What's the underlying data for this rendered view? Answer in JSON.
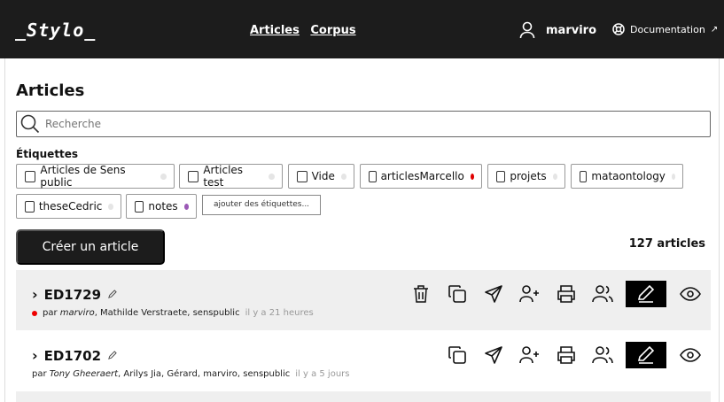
{
  "header": {
    "logo": "_Stylo_",
    "nav": [
      "Articles",
      "Corpus"
    ],
    "username": "marviro",
    "docs": "Documentation"
  },
  "page": {
    "title": "Articles",
    "search_placeholder": "Recherche",
    "tags_label": "Étiquettes",
    "tags": [
      {
        "label": "Articles de Sens public",
        "dot": "#e5e5e5"
      },
      {
        "label": "Articles test",
        "dot": "#e5e5e5"
      },
      {
        "label": "Vide",
        "dot": "#e5e5e5"
      },
      {
        "label": "articlesMarcello",
        "dot": "#e00000"
      },
      {
        "label": "projets",
        "dot": "#e5e5e5"
      },
      {
        "label": "mataontology",
        "dot": "#e5e5e5"
      },
      {
        "label": "theseCedric",
        "dot": "#e5e5e5"
      },
      {
        "label": "notes",
        "dot": "#9b59b6"
      }
    ],
    "add_tags": "ajouter des étiquettes...",
    "create_button": "Créer un article",
    "count": "127 articles"
  },
  "articles": [
    {
      "title": "ED1729",
      "by": "par ",
      "owner": "marviro",
      "others": ", Mathilde Verstraete, senspublic",
      "ago": "il y a 21 heures",
      "tag_dot": "#e00000"
    },
    {
      "title": "ED1702",
      "by": "par ",
      "owner": "Tony Gheeraert",
      "others": ", Arilys Jia, Gérard, marviro, senspublic",
      "ago": "il y a 5 jours",
      "tag_dot": ""
    }
  ]
}
